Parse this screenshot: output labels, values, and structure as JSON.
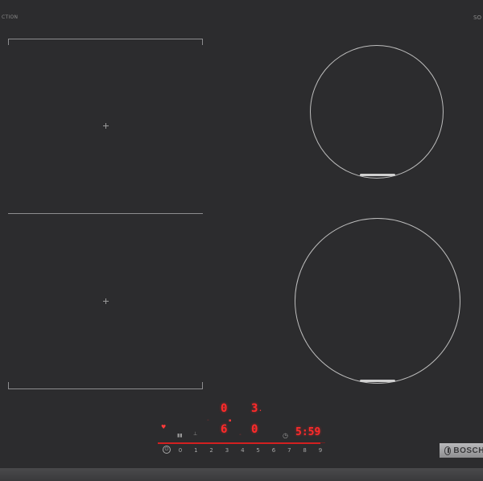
{
  "brand": {
    "top_left": "CTION",
    "top_right": "SO",
    "logo": "BOSCH"
  },
  "colors": {
    "surface": "#2c2c2e",
    "display_red": "#ff2a2a",
    "ring": "#bdbdbd"
  },
  "displays": {
    "zone_front_left_level": "0",
    "zone_rear_right_level": "3",
    "zone_mid_level": "0",
    "zone_left_level": "6",
    "timer": "5:59"
  },
  "control": {
    "scale": [
      "0",
      "1",
      "2",
      "3",
      "4",
      "5",
      "6",
      "7",
      "8",
      "9"
    ]
  },
  "icons": [
    "power-icon",
    "timer-icon",
    "bosch-logo-icon",
    "cross-marker-icon"
  ]
}
